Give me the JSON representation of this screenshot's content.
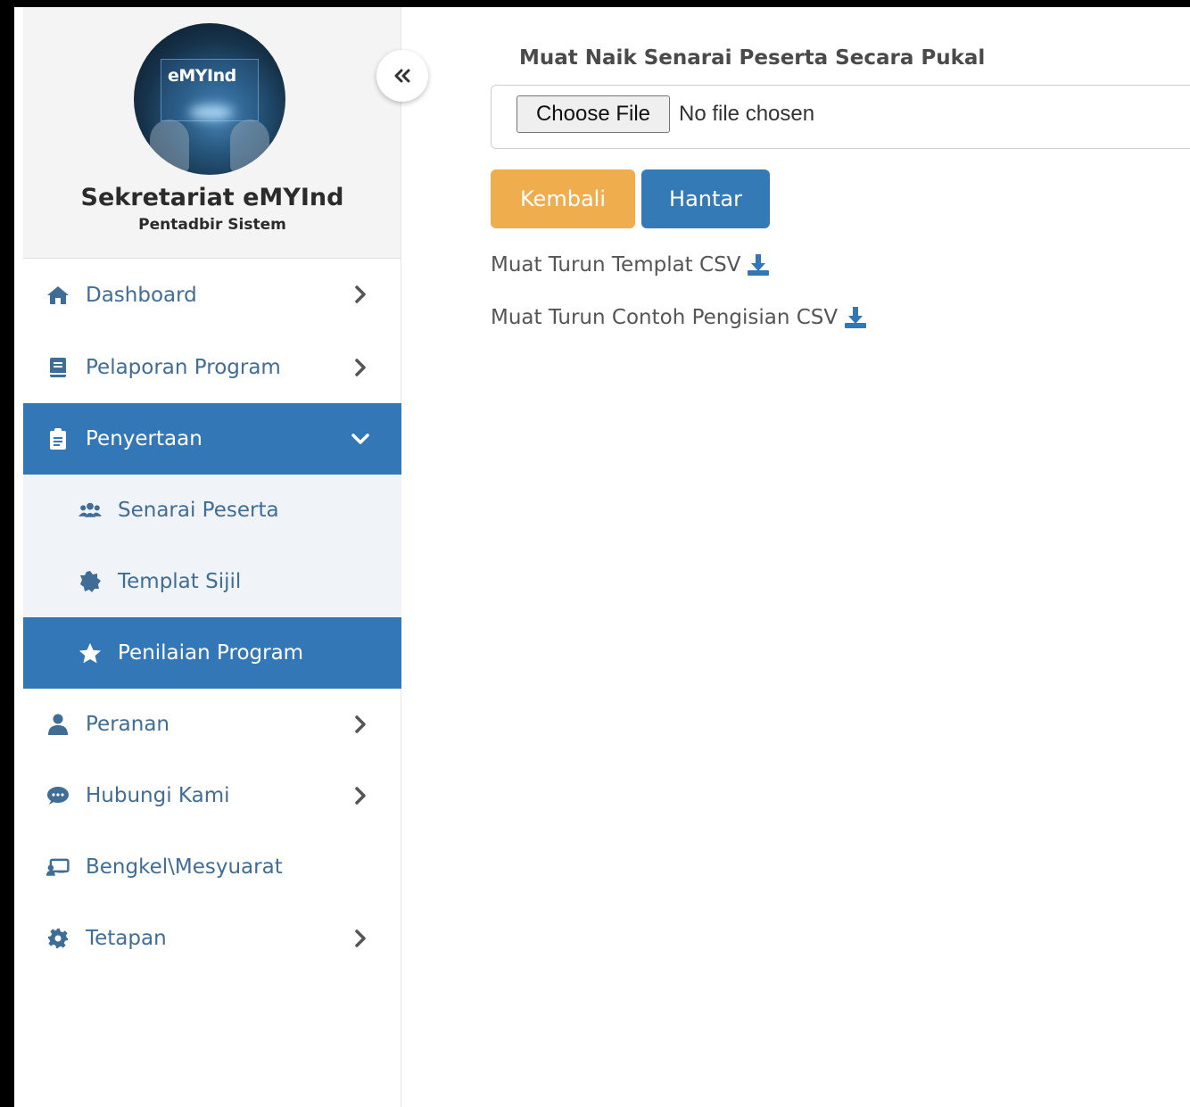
{
  "profile": {
    "logo_text": "eMYInd",
    "name": "Sekretariat eMYInd",
    "role": "Pentadbir Sistem"
  },
  "sidebar": {
    "items": [
      {
        "label": "Dashboard",
        "icon": "home-icon",
        "has_chevron": true
      },
      {
        "label": "Pelaporan Program",
        "icon": "book-icon",
        "has_chevron": true
      },
      {
        "label": "Penyertaan",
        "icon": "clipboard-icon",
        "active": true,
        "expanded": true,
        "children": [
          {
            "label": "Senarai Peserta",
            "icon": "users-icon"
          },
          {
            "label": "Templat Sijil",
            "icon": "certificate-icon"
          },
          {
            "label": "Penilaian Program",
            "icon": "star-icon",
            "active": true
          }
        ]
      },
      {
        "label": "Peranan",
        "icon": "user-icon",
        "has_chevron": true
      },
      {
        "label": "Hubungi Kami",
        "icon": "chat-icon",
        "has_chevron": true
      },
      {
        "label": "Bengkel\\Mesyuarat",
        "icon": "presentation-icon",
        "has_chevron": false
      },
      {
        "label": "Tetapan",
        "icon": "gear-icon",
        "has_chevron": true
      }
    ]
  },
  "main": {
    "upload_title": "Muat Naik Senarai Peserta Secara Pukal",
    "file_button_label": "Choose File",
    "file_status": "No file chosen",
    "back_button": "Kembali",
    "submit_button": "Hantar",
    "download_template": "Muat Turun Templat CSV",
    "download_example": "Muat Turun Contoh Pengisian CSV"
  },
  "colors": {
    "primary": "#3477b7",
    "warning": "#f0ad4e",
    "nav_text": "#3f6d96",
    "submenu_bg": "#f0f4f8"
  }
}
